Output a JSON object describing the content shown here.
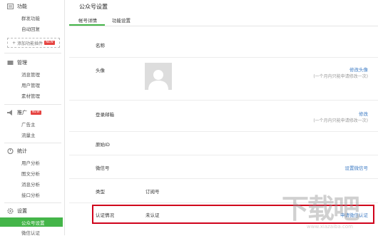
{
  "sidebar": {
    "func_title": "功能",
    "func_items": [
      "群发功能",
      "自动回复"
    ],
    "add_plugin": "添加功能插件",
    "new_badge": "NEW",
    "manage_title": "管理",
    "manage_items": [
      "消息管理",
      "用户管理",
      "素材管理"
    ],
    "promo_title": "推广",
    "promo_items": [
      "广告主",
      "流量主"
    ],
    "stats_title": "统计",
    "stats_items": [
      "用户分析",
      "图文分析",
      "消息分析",
      "接口分析"
    ],
    "settings_title": "设置",
    "settings_items": [
      "公众号设置",
      "微信认证"
    ]
  },
  "main": {
    "title": "公众号设置",
    "tabs": [
      "帐号详情",
      "功能设置"
    ],
    "rows": {
      "name_label": "名称",
      "avatar_label": "头像",
      "avatar_link": "修改头像",
      "avatar_note": "(一个月内只能申请修改一次)",
      "email_label": "登录邮箱",
      "email_link": "修改",
      "email_note": "(一个月内只能申请修改一次)",
      "origin_label": "原始ID",
      "wechat_label": "微信号",
      "wechat_link": "设置微信号",
      "type_label": "类型",
      "type_value": "订阅号",
      "cert_label": "认证情况",
      "cert_value": "未认证",
      "cert_link": "申请微信认证"
    }
  },
  "watermark": {
    "big": "下载吧",
    "small": "www.xiazaiba.com"
  },
  "colors": {
    "accent": "#44b549",
    "link": "#3d7bc4",
    "highlight": "#d0021b"
  }
}
